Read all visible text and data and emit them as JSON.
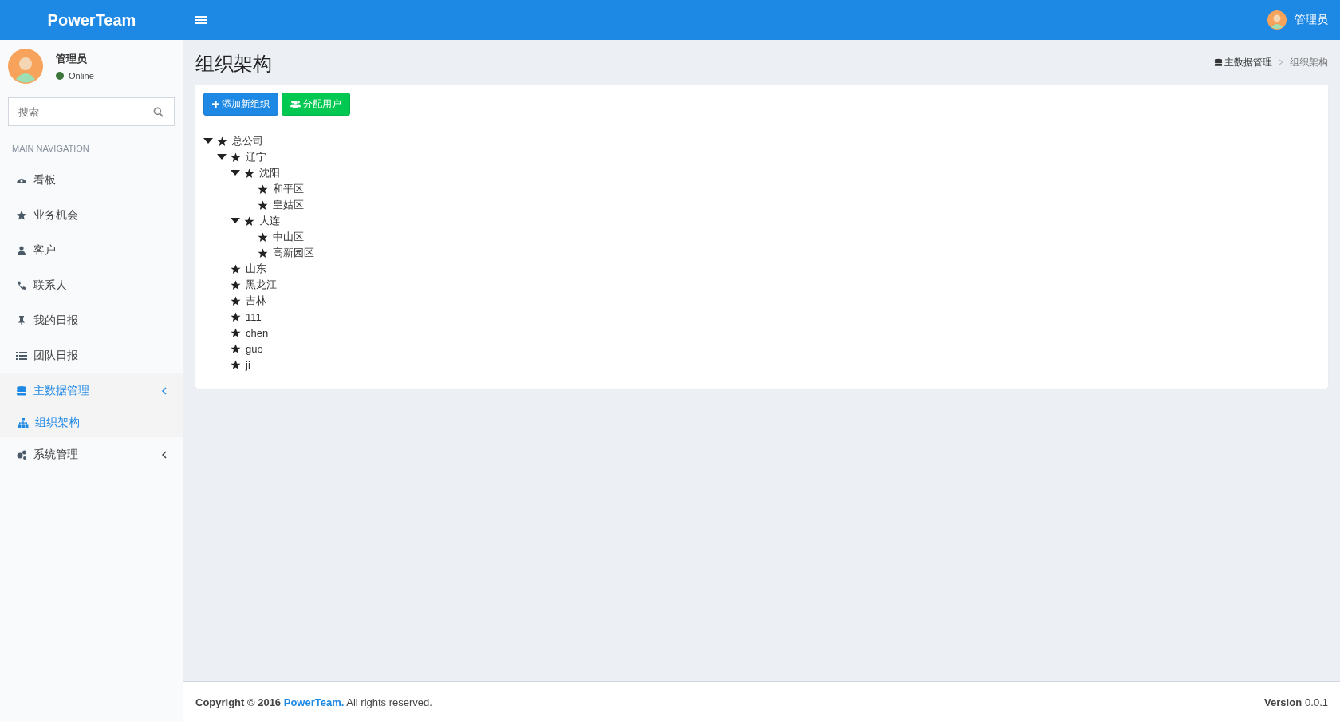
{
  "header": {
    "logo": "PowerTeam",
    "user_name": "管理员"
  },
  "sidebar": {
    "user": {
      "name": "管理员",
      "status": "Online",
      "online": true
    },
    "search": {
      "placeholder": "搜索"
    },
    "section_title": "MAIN NAVIGATION",
    "items": [
      {
        "label": "看板",
        "kind": "link",
        "selected": false
      },
      {
        "label": "业务机会",
        "kind": "link",
        "selected": false
      },
      {
        "label": "客户",
        "kind": "link",
        "selected": false
      },
      {
        "label": "联系人",
        "kind": "link",
        "selected": false
      },
      {
        "label": "我的日报",
        "kind": "link",
        "selected": false
      },
      {
        "label": "团队日报",
        "kind": "link",
        "selected": false
      },
      {
        "label": "主数据管理",
        "kind": "submenu",
        "selected": true,
        "expanded": true,
        "children": [
          {
            "label": "组织架构",
            "selected": true
          }
        ]
      },
      {
        "label": "系统管理",
        "kind": "submenu",
        "selected": false
      }
    ]
  },
  "page": {
    "title": "组织架构",
    "breadcrumb": [
      "主数据管理",
      "组织架构"
    ]
  },
  "toolbar": {
    "buttons": [
      {
        "label": "添加新组织",
        "kind": "primary"
      },
      {
        "label": "分配用户",
        "kind": "success"
      }
    ]
  },
  "tree": [
    {
      "label": "总公司",
      "expanded": true,
      "children": [
        {
          "label": "辽宁",
          "expanded": true,
          "children": [
            {
              "label": "沈阳",
              "expanded": true,
              "children": [
                {
                  "label": "和平区"
                },
                {
                  "label": "皇姑区"
                }
              ]
            },
            {
              "label": "大连",
              "expanded": true,
              "children": [
                {
                  "label": "中山区"
                },
                {
                  "label": "高新园区"
                }
              ]
            }
          ]
        },
        {
          "label": "山东"
        },
        {
          "label": "黑龙江"
        },
        {
          "label": "吉林"
        },
        {
          "label": "111"
        },
        {
          "label": "chen"
        },
        {
          "label": "guo"
        },
        {
          "label": "ji"
        }
      ]
    }
  ],
  "footer": {
    "copyright_lead": "Copyright © 2016",
    "copyright_link": "PowerTeam.",
    "copyright_tail": "All rights reserved.",
    "version_label": "Version",
    "version_number": "0.0.1"
  }
}
